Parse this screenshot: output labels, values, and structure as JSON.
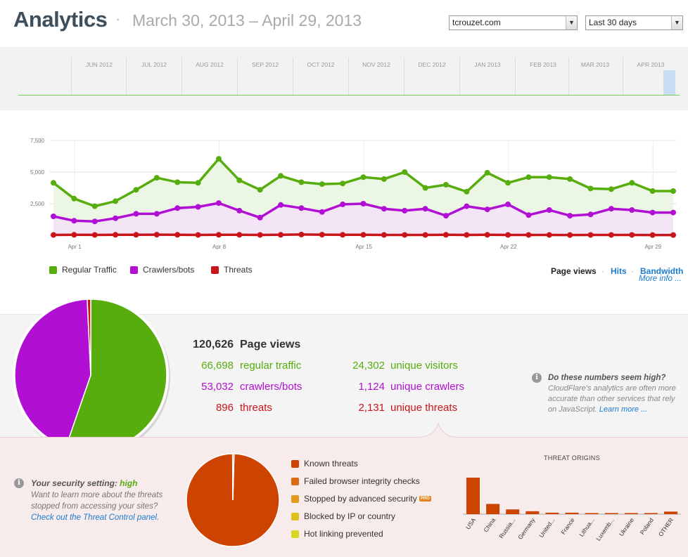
{
  "header": {
    "title": "Analytics",
    "separator": "·",
    "date_range": "March 30, 2013 – April 29, 2013",
    "site_select": "tcrouzet.com",
    "period_select": "Last 30 days"
  },
  "timeline": {
    "months": [
      "JUN 2012",
      "JUL 2012",
      "AUG 2012",
      "SEP 2012",
      "OCT 2012",
      "NOV 2012",
      "DEC 2012",
      "JAN 2013",
      "FEB 2013",
      "MAR 2013",
      "APR 2013"
    ]
  },
  "chart_data": {
    "type": "area",
    "y_ticks": [
      "7,500",
      "5,000",
      "2,500"
    ],
    "ylim": [
      0,
      7500
    ],
    "x_tick_labels": [
      "Apr 1",
      "Apr 8",
      "Apr 15",
      "Apr 22",
      "Apr 29"
    ],
    "x_tick_index": [
      1,
      8,
      15,
      22,
      29
    ],
    "grid": true,
    "series": [
      {
        "name": "Regular Traffic",
        "color": "#57ad0e",
        "fill": "#ebf6e3",
        "values": [
          4150,
          2900,
          2300,
          2700,
          3600,
          4550,
          4200,
          4150,
          6050,
          4350,
          3600,
          4700,
          4200,
          4050,
          4100,
          4600,
          4450,
          5000,
          3750,
          4000,
          3450,
          4950,
          4150,
          4600,
          4600,
          4450,
          3700,
          3650,
          4150,
          3500,
          3500
        ]
      },
      {
        "name": "Crawlers/bots",
        "color": "#b10fd3",
        "fill": "#f3e3f7",
        "values": [
          1500,
          1150,
          1100,
          1350,
          1700,
          1700,
          2150,
          2250,
          2550,
          1950,
          1400,
          2400,
          2150,
          1850,
          2450,
          2500,
          2100,
          1950,
          2100,
          1550,
          2300,
          2050,
          2450,
          1600,
          2000,
          1550,
          1650,
          2100,
          2000,
          1800,
          1800
        ]
      },
      {
        "name": "Threats",
        "color": "#c8151a",
        "fill": "#f6dada",
        "values": [
          30,
          40,
          30,
          40,
          40,
          50,
          40,
          30,
          40,
          40,
          30,
          40,
          60,
          50,
          40,
          40,
          30,
          30,
          30,
          40,
          30,
          40,
          30,
          30,
          30,
          20,
          30,
          30,
          30,
          20,
          20
        ]
      }
    ]
  },
  "legend": {
    "regular": "Regular Traffic",
    "crawlers": "Crawlers/bots",
    "threats": "Threats"
  },
  "metrics": {
    "pageviews": "Page views",
    "sep1": "·",
    "hits": "Hits",
    "sep2": "·",
    "bandwidth": "Bandwidth",
    "more_info": "More info ..."
  },
  "summary": {
    "total_num": "120,626",
    "total_label": "Page views",
    "regular_num": "66,698",
    "regular_label": "regular traffic",
    "crawlers_num": "53,032",
    "crawlers_label": "crawlers/bots",
    "threats_num": "896",
    "threats_label": "threats",
    "uv_num": "24,302",
    "uv_label": "unique visitors",
    "uc_num": "1,124",
    "uc_label": "unique crawlers",
    "ut_num": "2,131",
    "ut_label": "unique threats",
    "pie": {
      "regular": 66698,
      "crawlers": 53032,
      "threats": 896
    },
    "note_title": "Do these numbers seem high?",
    "note_body": "CloudFlare's analytics are often more accurate than other services that rely on JavaScript.",
    "note_link": "Learn more ..."
  },
  "threats": {
    "security_label": "Your security setting:",
    "security_value": "high",
    "security_body": "Want to learn more about the threats stopped from accessing your sites?",
    "security_link": "Check out the Threat Control panel.",
    "legend": [
      {
        "label": "Known threats",
        "color": "#cc4400"
      },
      {
        "label": "Failed browser integrity checks",
        "color": "#db6a12"
      },
      {
        "label": "Stopped by advanced security",
        "color": "#e39a1e",
        "badge": "PRO"
      },
      {
        "label": "Blocked by IP or country",
        "color": "#dfbf1e"
      },
      {
        "label": "Hot linking prevented",
        "color": "#d9d622"
      }
    ],
    "pie": {
      "known": 99.5,
      "other": 0.5
    },
    "origins_title": "THREAT ORIGINS",
    "origins": {
      "type": "bar",
      "categories": [
        "USA",
        "China",
        "Russia...",
        "Germany",
        "United...",
        "France",
        "Lithua...",
        "Luxemb...",
        "Ukraine",
        "Poland",
        "OTHER"
      ],
      "values": [
        100,
        28,
        13,
        8,
        4,
        4,
        3,
        3,
        3,
        3,
        7
      ],
      "color": "#cc4400"
    }
  }
}
